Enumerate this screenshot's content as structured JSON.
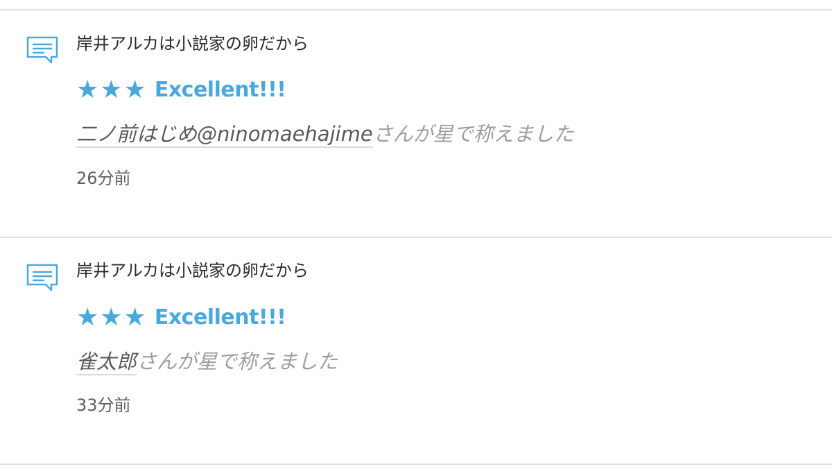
{
  "colors": {
    "accent": "#4aa8dc",
    "divider": "#e0e0e0",
    "title_text": "#2a2a2a",
    "user_text": "#5a5a5a",
    "muted_text": "#9e9e9e",
    "time_text": "#5f5f5f"
  },
  "notifications": [
    {
      "icon": "comment-icon",
      "title": "岸井アルカは小説家の卵だから",
      "stars": "★★★",
      "rating_label": "Excellent!!!",
      "user": "二ノ前はじめ@ninomaehajime",
      "praise_suffix": "さんが星で称えました",
      "time": "26分前"
    },
    {
      "icon": "comment-icon",
      "title": "岸井アルカは小説家の卵だから",
      "stars": "★★★",
      "rating_label": "Excellent!!!",
      "user": "雀太郎",
      "praise_suffix": "さんが星で称えました",
      "time": "33分前"
    }
  ]
}
